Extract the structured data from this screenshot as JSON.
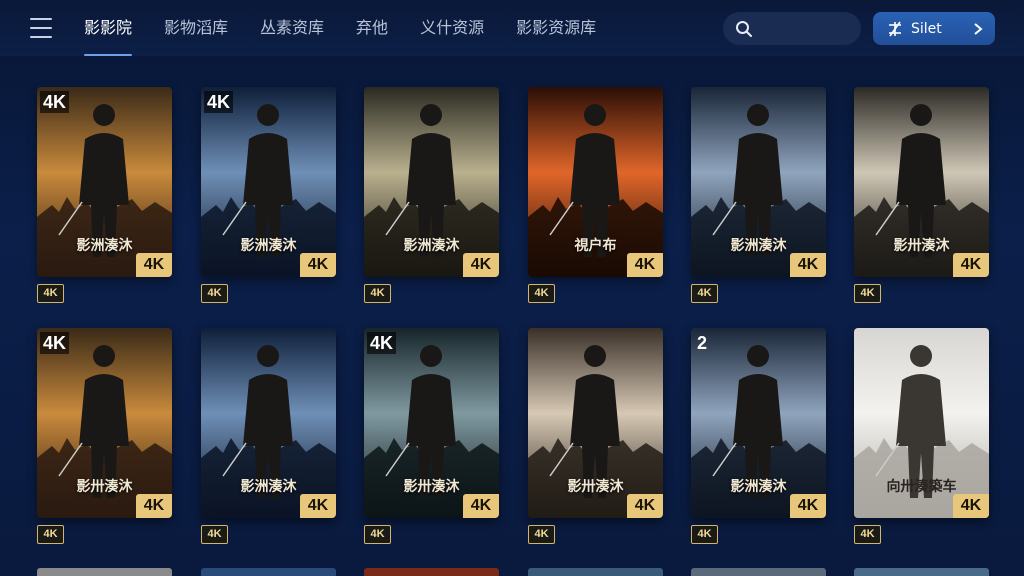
{
  "nav": {
    "tabs": [
      {
        "label": "影影院",
        "active": true
      },
      {
        "label": "影物滔库",
        "active": false
      },
      {
        "label": "丛素资库",
        "active": false
      },
      {
        "label": "弃他",
        "active": false
      },
      {
        "label": "义什资源",
        "active": false
      },
      {
        "label": "影影资源库",
        "active": false
      }
    ]
  },
  "search": {
    "placeholder": "",
    "icon": "search-icon"
  },
  "select_button": {
    "label": "Silet",
    "icon": "asterisk-icon",
    "arrow": "chevron-right-icon"
  },
  "colors": {
    "accent": "#2a62b5",
    "badge_gold": "#e8c77a",
    "background": "#0b1f4a"
  },
  "posters": [
    {
      "top_badge": "4K",
      "title": "影洲湊沐",
      "badge": "4K",
      "quality": "4K",
      "theme": "amber"
    },
    {
      "top_badge": "4K",
      "title": "影洲湊沐",
      "badge": "4K",
      "quality": "4K",
      "theme": "blue"
    },
    {
      "top_badge": "",
      "title": "影洲湊沐",
      "badge": "4K",
      "quality": "4K",
      "theme": "olive"
    },
    {
      "top_badge": "",
      "title": "視户布",
      "badge": "4K",
      "quality": "4K",
      "theme": "fire"
    },
    {
      "top_badge": "",
      "title": "影洲湊沐",
      "badge": "4K",
      "quality": "4K",
      "theme": "steel"
    },
    {
      "top_badge": "",
      "title": "影卅湊沐",
      "badge": "4K",
      "quality": "4K",
      "theme": "mist"
    },
    {
      "top_badge": "4K",
      "title": "影卅湊沐",
      "badge": "4K",
      "quality": "4K",
      "theme": "amber"
    },
    {
      "top_badge": "",
      "title": "影洲湊沐",
      "badge": "4K",
      "quality": "4K",
      "theme": "blue"
    },
    {
      "top_badge": "4K",
      "title": "影卅湊沐",
      "badge": "4K",
      "quality": "4K",
      "theme": "teal"
    },
    {
      "top_badge": "",
      "title": "影卅湊沐",
      "badge": "4K",
      "quality": "4K",
      "theme": "sand"
    },
    {
      "top_badge": "2",
      "title": "影洲湊沐",
      "badge": "4K",
      "quality": "4K",
      "theme": "steel"
    },
    {
      "top_badge": "",
      "title": "向卅湊築车",
      "badge": "4K",
      "quality": "4K",
      "theme": "light"
    }
  ]
}
